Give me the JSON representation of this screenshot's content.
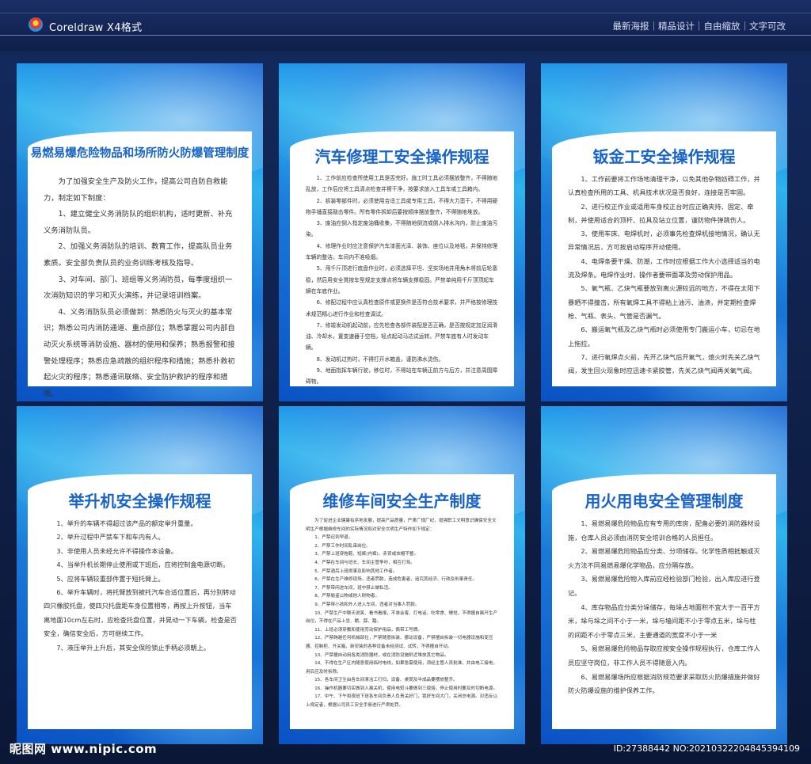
{
  "header": {
    "brand": "Coreldraw  X4格式",
    "tags": "最新海报｜精品设计｜自由缩放｜文字可改"
  },
  "watermark": {
    "site": "昵图网 www.nipic.com",
    "id": "ID:27388442 NO:20210322204845394109"
  },
  "cards": [
    {
      "title": "易燃易爆危险物品和场所防火防爆管理制度",
      "paragraphs": [
        "为了加强安全生产及防火工作，提高公司自防自救能力，制定如下制度：",
        "1、建立健全义务消防队的组织机构，适时更新、补充义务消防队员。",
        "2、加强义务消防队的培训、教育工作，提高队员业务素质。安全部负责队员的业务训练考核及指导。",
        "3、对车间、部门、班组等义务消防员，每季度组织一次消防知识的学习和灭火演练，并记录培训档案。",
        "4、义务消防队员必须做到：熟悉防火与灭火的基本常识；熟悉公司内消防通道、重点部位；熟悉掌握公司内部自动灭火系统等消防设施、器材的使用和保养；熟悉报警和接警处理程序；熟悉应急疏散的组织程序和措施；熟悉扑救初起火灾的程序；熟悉通讯联络、安全防护救护的程序和措施。"
      ]
    },
    {
      "title": "汽车修理工安全操作规程",
      "paragraphs": [
        "1、工作前应检查所使用工具是否完好。施工时工具必须摆放整齐，不得随地乱放，工作后应将工具清点检查并擦干净，按要求放入工具车或工具箱内。",
        "2、拆装零部件时，必须使用合适工具或专用工具，不得大力蛮干，不得用硬物手锤直接敲击零件。所有零件拆卸后要按顺序摆放整齐，不得随地堆放。",
        "3、废油应倒入指定废油桶收集，不得随地倒流或倒入排水沟内，防止废油污染。",
        "4、修理作业时应注意保护汽车漆面光泽、装饰、座位以及地毯，并保持修理车辆的整洁。车间内不准吸烟。",
        "5、用千斤顶进行底盘作业时，必须选择平坦、坚实场地并用角木将前后轮塞稳，然后用安全凳按车型规定支撑点将车辆支撑稳固。严禁单纯用千斤顶顶起车辆在车底作业。",
        "6、修配过程中应认真检查原件或更换件是否符合技术要求，并严格按修理技术规范精心进行作业和检查调试。",
        "7、修竣发动机起动前，应先检查各部件装配是否正确，是否按规定加足润滑油、冷却水，置变速器于空档，轻点起动马达试运转。严禁车底有人时发动车辆。",
        "8、发动机过热时，不得打开水箱盖，谨防沸水烫伤。",
        "9、地面指挥车辆行驶，移位时，不得站在车辆正前方与后方，并注意周围障碍物。"
      ]
    },
    {
      "title": "钣金工安全操作规程",
      "paragraphs": [
        "1、工作前要将工作场地清理干净，以免其他杂物妨碍工作，并认真检查所用的工具、机具技术状况是否良好，连接是否牢固。",
        "2、进行校正作业或适用车身校正台时应正确夹持、固定、牵制，并使用适合的顶杆、拉具及站立位置，谨防物件弹跳伤人。",
        "3、使用车床、电焊机时，必须事先检查焊机接地情况，确认无异常情况后，方可按启动程序开动使用。",
        "4、电焊条要干燥、防潮，工作时应根据工作大小选择适当的电流及焊条。电焊作业时，操作者要带面罩及劳动保护用品。",
        "5、氧气瓶、乙炔气瓶要放到离火源较远的地方，不得在太阳下暴晒不得撞击，所有氧焊工具不得粘上油污、油渍，并定期检查焊枪、气瓶、表头、气管是否漏气。",
        "6、搬运氧气瓶及乙炔气瓶时必须使用专门搬运小车，切忌在地上拖拉。",
        "7、进行氧焊点火前，先开乙炔气后开氧气，熄火时先关乙炔气阀，发生回火现象时应迅速卡紧胶管，先关乙炔气阀再关氧气阀。"
      ]
    },
    {
      "title": "举升机安全操作规程",
      "paragraphs": [
        "1、举升的车辆不得超过该产品的额定举升重量。",
        "2、举升过程中严禁车下和车内有人。",
        "3、非使用人员未经允许不得操作本设备。",
        "4、当举升机长期停止使用或下班后，应将控制盒电源切断。",
        "5、应将车辆较重部件置于短托臂上。",
        "6、举升车辆时，将托臂放到被托汽车合适位置后，再分别转动四只橡胶托盘，使四只托盘距车身位置相等，再按上升按钮，当车离地面10cm左右时，应检查托盘位置，并晃动一下车辆，检查是否安全，确信安全后，方可继续工作。",
        "7、液压举升上升后，其安全保险锁止手柄必须朝上。"
      ]
    },
    {
      "title": "维修车间安全生产制度",
      "paragraphs": [
        "为了促进企业健康有序地发展，提高产品质量，严肃厂规厂纪，增强职工文明意识确保安全文明生产根据维修车间的实际情况和对安全文明生产特作如下规定：",
        "1、严禁迟到早退。",
        "2、严禁工作时间乱串岗位。",
        "3、严禁上班穿拖鞋、短裤(内裤)、赤背或衣帽不整。",
        "4、严禁在车间与班长、车间主管争吵，相互打骂。",
        "5、严禁酒后上班闹事及影响其他工作者。",
        "6、严禁在生产维修现场，违者罚款，造成危害者，追究其经济、行政及刑事责任。",
        "7、严禁带闲进车间，班中禁止做私活。",
        "8、严禁偷盗公物或他人财物者。",
        "9、严禁带小孩和外人进入车间，违者对当事人罚款。",
        "10、严禁生产中聊天说笑、看书看报，不准会客、打电话、吃零食、睡觉，不得擅自离开生产岗位，不得在产品上坐、躺、踩、踏。",
        "11、上班必须穿戴和使用劳动保护用品，佩带工号牌。",
        "12、严禁跨越任何机械部位，严禁随意拆装、挪动设备，严禁擅自拆装一切电器设施和变压器、控制柜、开关箱，新安装的各种设备未经测试、试转，不得擅自开动。",
        "13、严禁擅自动用各类消防器材，或在消防设施附近堆放其它物品。",
        "14、不得在生产区内随意使用临时电线，如果急需使用，须经主管人员批准，并由电工接电，用后应及时拆除。",
        "15、各车间卫生由各车间清洁工打扫，设备、桌凳及半成品要摆放整齐。",
        "16、操作机器要切实做到人离关机，使用电熨斗要做到三熄熔，停止使用时要及时切断电源。",
        "17、中午、下午和夜班下班各车间负责人负责关好门，锁好车间大门，关闭总电源。对违反以上规定者，根据公司员工安全手册进行严肃处罚。"
      ]
    },
    {
      "title": "用火用电安全管理制度",
      "paragraphs": [
        "1、易燃易爆危险物品应有专用的库房，配备必要的消防器材设施，仓库人员必须由消防安全培训合格的人员担任。",
        "2、易燃易爆危险物品应分类、分项储存。化学性质相抵触或灭火方法不同易燃易爆化学物品，应分隔存放。",
        "3、易燃易爆危险物入库前应经检验部门检验，出入库应进行登记。",
        "4、库存物品应分类分垛储存，每垛占地面积不宜大于一百平方米，垛与垛之间不小于一米，垛与墙间距不小于零点五米，垛与柱的间距不小于零点三米，主要通道的宽度不小于一米",
        "5、易燃易爆危险物品存取应按安全操作规程执行，仓库工作人员应坚守岗位，非工作人员不得随意入内。",
        "6、易燃易爆场所应根据消防规范要求采取防火防爆措施并做好防火防爆设施的维护保养工作。"
      ]
    }
  ]
}
